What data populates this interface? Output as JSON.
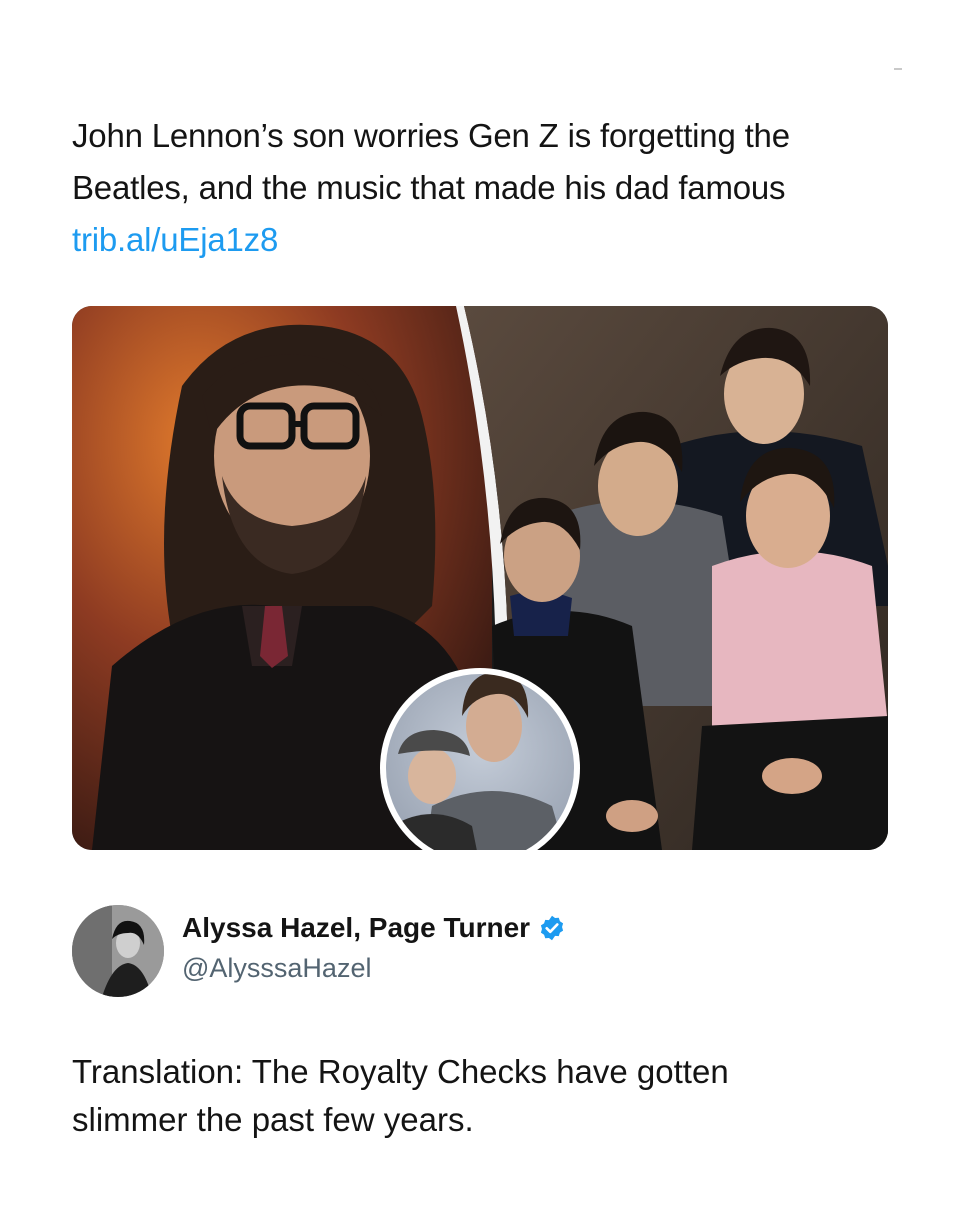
{
  "quoted_post": {
    "text_line_1": "John Lennon’s son worries Gen Z is forgetting the",
    "text_line_2": "Beatles, and the music that made his dad famous",
    "link": "trib.al/uEja1z8"
  },
  "media": {
    "left_photo": "man-with-long-hair-and-glasses-photo",
    "right_photo": "four-band-members-group-photo",
    "inset_photo": "couple-portrait-inset"
  },
  "author": {
    "name": "Alyssa Hazel, Page Turner",
    "handle": "@AlysssaHazel",
    "verified_icon": "verified-badge-icon",
    "accent_color": "#1d9bf0"
  },
  "reply": {
    "text_line_1": "Translation: The Royalty Checks have gotten",
    "text_line_2": "slimmer the past few years."
  }
}
